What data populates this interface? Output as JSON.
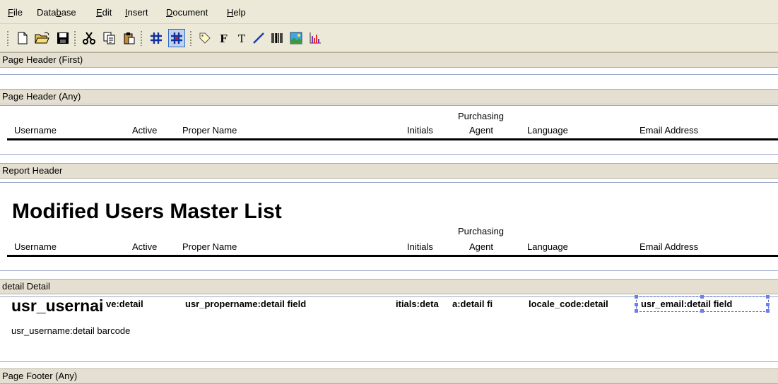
{
  "menubar": {
    "items": [
      {
        "pre": "",
        "key": "F",
        "post": "ile"
      },
      {
        "pre": "Data",
        "key": "b",
        "post": "ase"
      },
      {
        "pre": "",
        "key": "E",
        "post": "dit"
      },
      {
        "pre": "",
        "key": "I",
        "post": "nsert"
      },
      {
        "pre": "",
        "key": "D",
        "post": "ocument"
      },
      {
        "pre": "",
        "key": "H",
        "post": "elp"
      }
    ]
  },
  "toolbar": {
    "icons": [
      "new-icon",
      "open-icon",
      "save-icon",
      "cut-icon",
      "copy-icon",
      "paste-icon",
      "grid-icon",
      "snap-grid-icon",
      "label-tag-icon",
      "bold-font-icon",
      "text-icon",
      "line-icon",
      "barcode-icon",
      "image-icon",
      "chart-icon"
    ]
  },
  "bands": {
    "page_header_first": "Page Header (First)",
    "page_header_any": "Page Header (Any)",
    "report_header": "Report Header",
    "detail": "detail Detail",
    "page_footer_any": "Page Footer (Any)"
  },
  "columns": {
    "username": "Username",
    "active": "Active",
    "proper_name": "Proper Name",
    "initials": "Initials",
    "purchasing_line1": "Purchasing",
    "purchasing_line2": "Agent",
    "language": "Language",
    "email": "Email Address"
  },
  "report_title": "Modified Users Master List",
  "detail_fields": {
    "username_big": "usr_usernai",
    "active": "ve:detail",
    "propername": "usr_propername:detail field",
    "initials": "itials:deta",
    "agent": "a:detail fi",
    "locale": "locale_code:detail",
    "email": "usr_email:detail field",
    "barcode": "usr_username:detail barcode"
  }
}
